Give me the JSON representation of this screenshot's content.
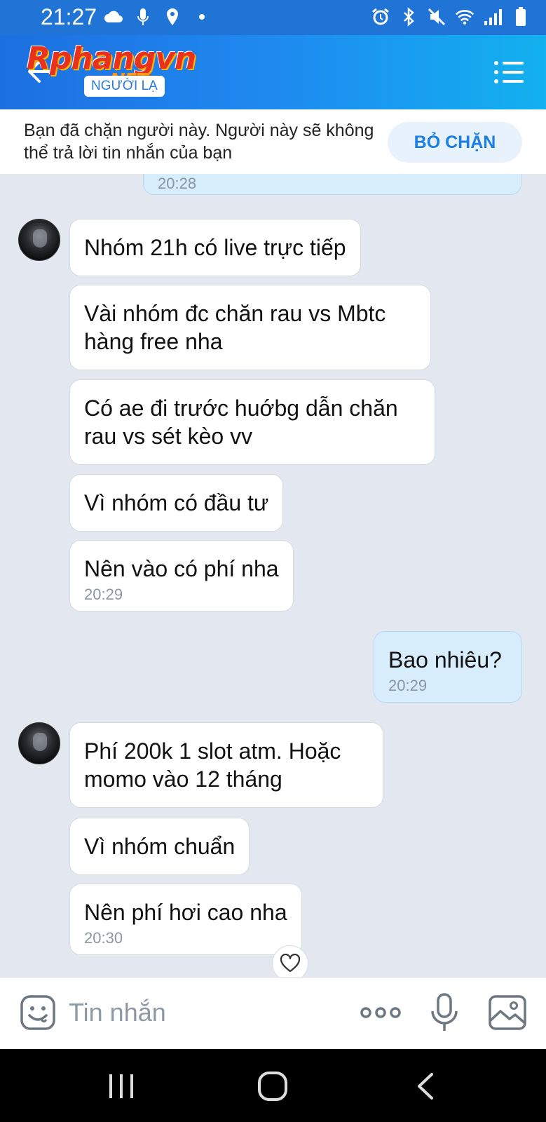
{
  "status_bar": {
    "time": "21:27"
  },
  "header": {
    "logo_main": "Rphangvn",
    "logo_sub": ".NET",
    "stranger_label": "NGƯỜI LẠ"
  },
  "block_banner": {
    "text": "Bạn đã chặn người này. Người này sẽ không thể trả lời tin nhắn của bạn",
    "button_label": "BỎ CHẶN"
  },
  "messages": [
    {
      "from": "me",
      "text": "",
      "time": "20:28"
    },
    {
      "from": "them",
      "text": "Nhóm 21h có live trực tiếp",
      "time": ""
    },
    {
      "from": "them",
      "text": "Vài nhóm đc chăn rau vs Mbtc hàng free nha",
      "time": ""
    },
    {
      "from": "them",
      "text": "Có ae đi trước huớbg dẫn chăn rau vs sét kèo vv",
      "time": ""
    },
    {
      "from": "them",
      "text": "Vì nhóm có đầu tư",
      "time": ""
    },
    {
      "from": "them",
      "text": "Nên vào có phí nha",
      "time": "20:29"
    },
    {
      "from": "me",
      "text": "Bao nhiêu?",
      "time": "20:29"
    },
    {
      "from": "them",
      "text": "Phí 200k 1 slot atm. Hoặc momo vào 12 tháng",
      "time": ""
    },
    {
      "from": "them",
      "text": "Vì nhóm chuẩn",
      "time": ""
    },
    {
      "from": "them",
      "text": "Nên phí hơi cao nha",
      "time": "20:30"
    }
  ],
  "input_bar": {
    "placeholder": "Tin nhắn"
  },
  "icons": {
    "status_left": [
      "cloud-icon",
      "mic-icon",
      "location-icon",
      "dot-icon"
    ],
    "status_right": [
      "alarm-icon",
      "bluetooth-icon",
      "mute-icon",
      "wifi-icon",
      "signal-icon",
      "battery-icon"
    ],
    "nav": [
      "recent-apps-icon",
      "home-icon",
      "back-icon"
    ]
  },
  "colors": {
    "header_start": "#1d6fe0",
    "header_end": "#13b1ef",
    "accent": "#1a7fe0",
    "my_bubble": "#d8edfc",
    "chat_background": "#e3e8f0"
  }
}
